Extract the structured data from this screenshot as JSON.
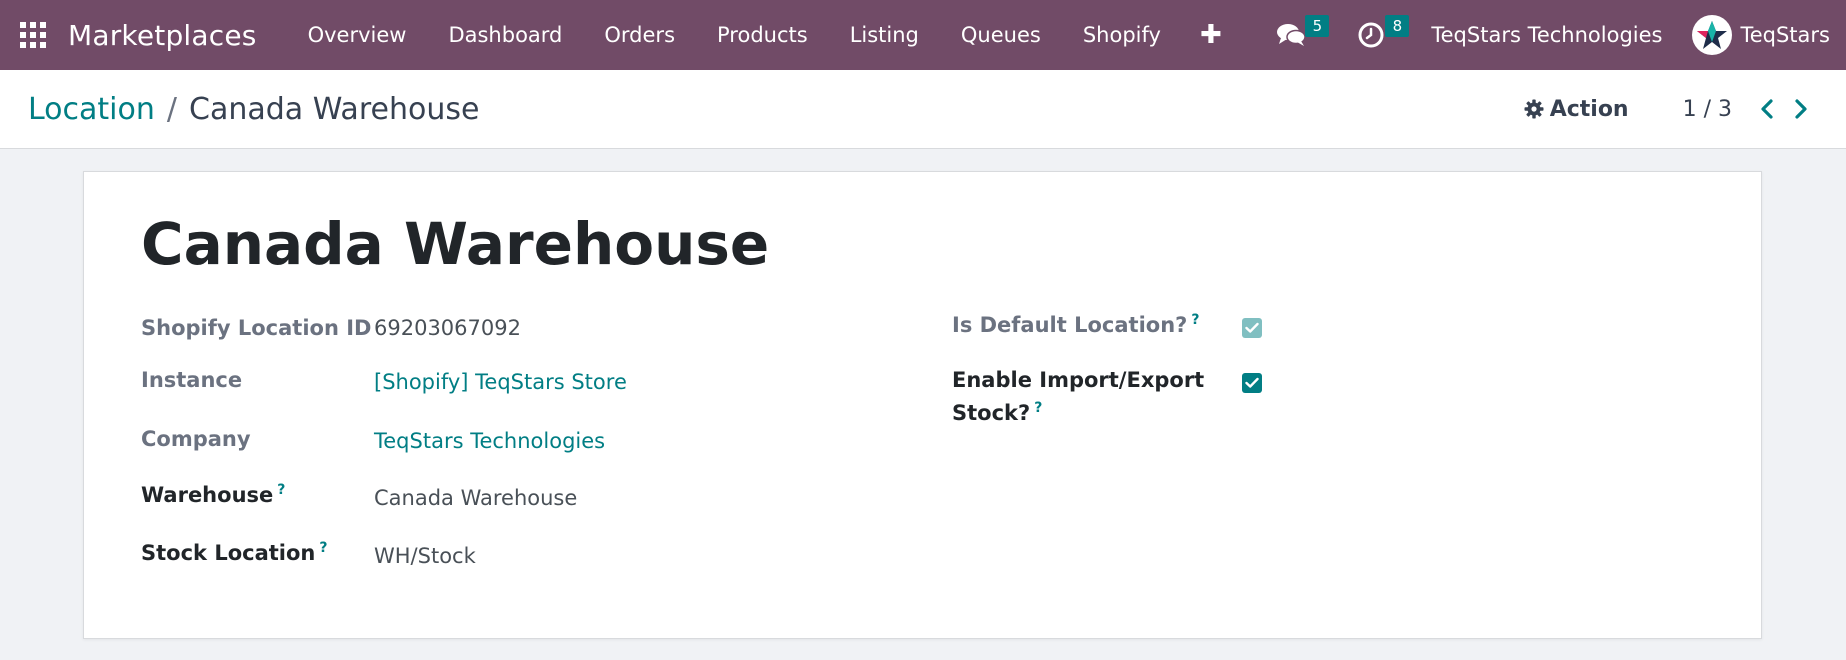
{
  "navbar": {
    "brand": "Marketplaces",
    "menu": [
      "Overview",
      "Dashboard",
      "Orders",
      "Products",
      "Listing",
      "Queues",
      "Shopify"
    ],
    "messages_count": "5",
    "activities_count": "8",
    "company": "TeqStars Technologies",
    "user": "TeqStars"
  },
  "breadcrumb": {
    "parent": "Location",
    "separator": "/",
    "current": "Canada Warehouse"
  },
  "control": {
    "action_label": "Action",
    "pager": "1 / 3"
  },
  "record": {
    "title": "Canada Warehouse",
    "fields_left": [
      {
        "label": "Shopify Location ID",
        "value": "69203067092"
      },
      {
        "label": "Instance",
        "value": "[Shopify] TeqStars Store"
      },
      {
        "label": "Company",
        "value": "TeqStars Technologies"
      },
      {
        "label": "Warehouse",
        "value": "Canada Warehouse",
        "help": "?"
      },
      {
        "label": "Stock Location",
        "value": "WH/Stock",
        "help": "?"
      }
    ],
    "fields_right": [
      {
        "label": "Is Default Location?",
        "help": "?",
        "checked": true,
        "readonly": true
      },
      {
        "label_line1": "Enable Import/Export",
        "label_line2": "Stock?",
        "help": "?",
        "checked": true,
        "readonly": false
      }
    ]
  },
  "colors": {
    "navbar": "#714b67",
    "accent": "#017e84",
    "checkbox_disabled": "#80bfc1"
  }
}
